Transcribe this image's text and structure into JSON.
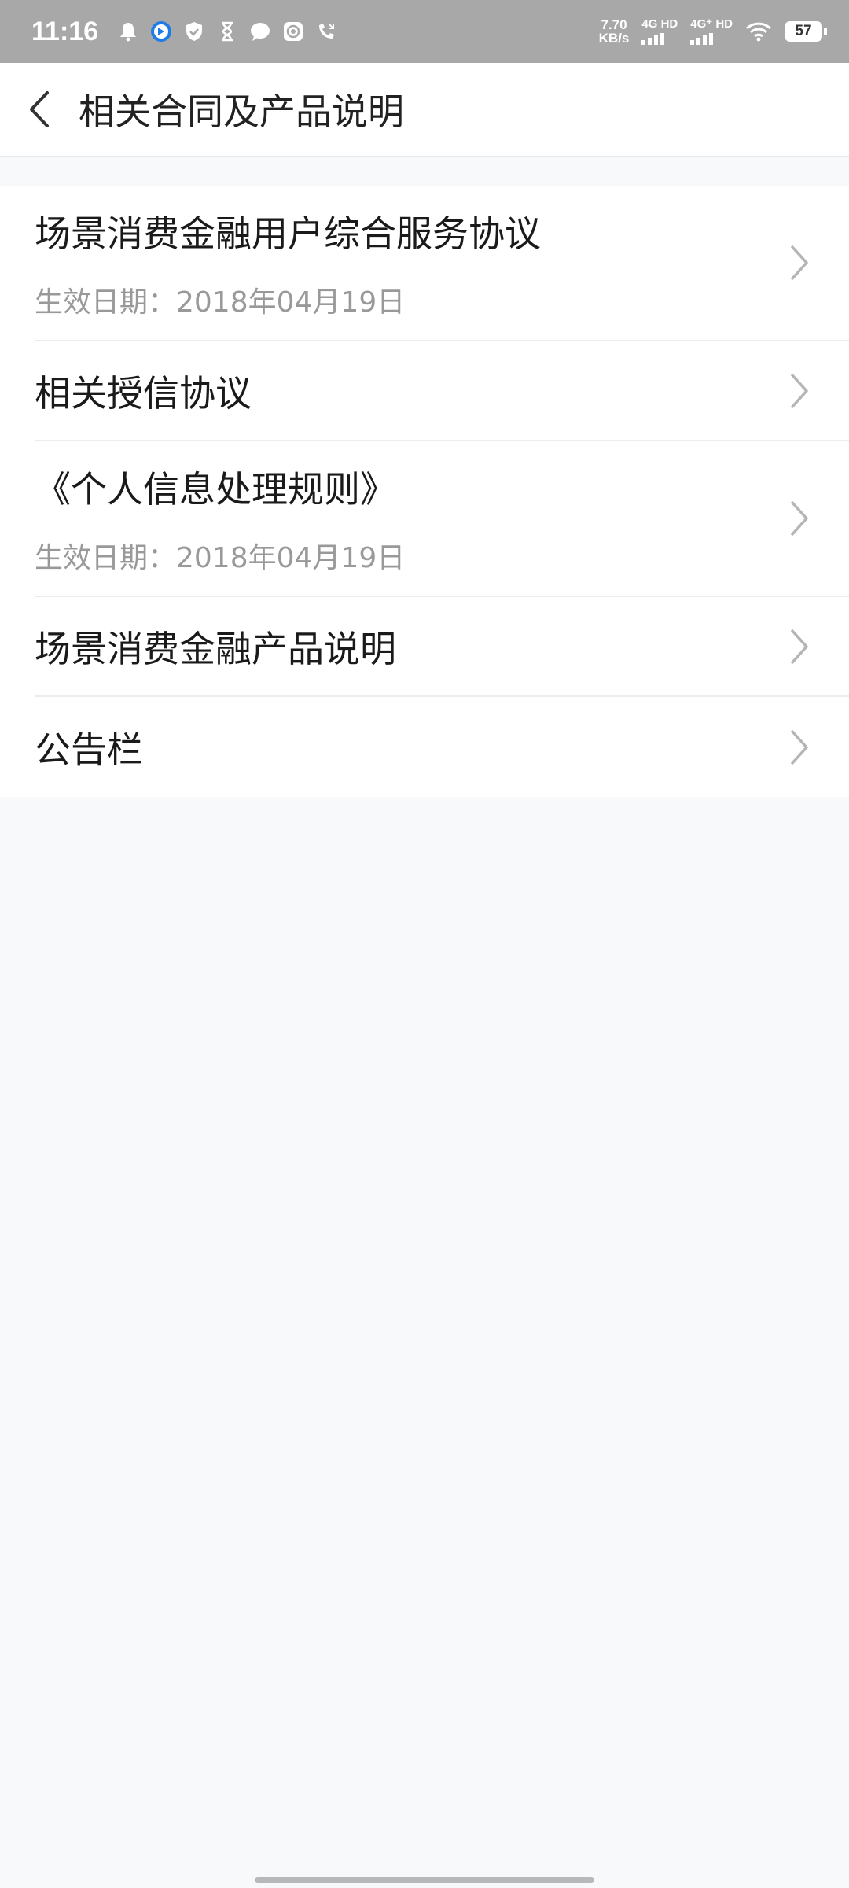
{
  "status_bar": {
    "time": "11:16",
    "speed_value": "7.70",
    "speed_unit": "KB/s",
    "net1": "4G HD",
    "net2": "4G⁺ HD",
    "battery": "57"
  },
  "header": {
    "title": "相关合同及产品说明"
  },
  "items": [
    {
      "title": "场景消费金融用户综合服务协议",
      "date": "生效日期：2018年04月19日"
    },
    {
      "title": "相关授信协议"
    },
    {
      "title": "《个人信息处理规则》",
      "date": "生效日期：2018年04月19日"
    },
    {
      "title": "场景消费金融产品说明"
    },
    {
      "title": "公告栏"
    }
  ],
  "icons": {
    "back": "chevron-left-icon",
    "row": "chevron-right-icon"
  },
  "colors": {
    "status_bar_bg": "#a8a8a8",
    "page_bg": "#f8f9fb",
    "secondary_text": "#999999"
  }
}
